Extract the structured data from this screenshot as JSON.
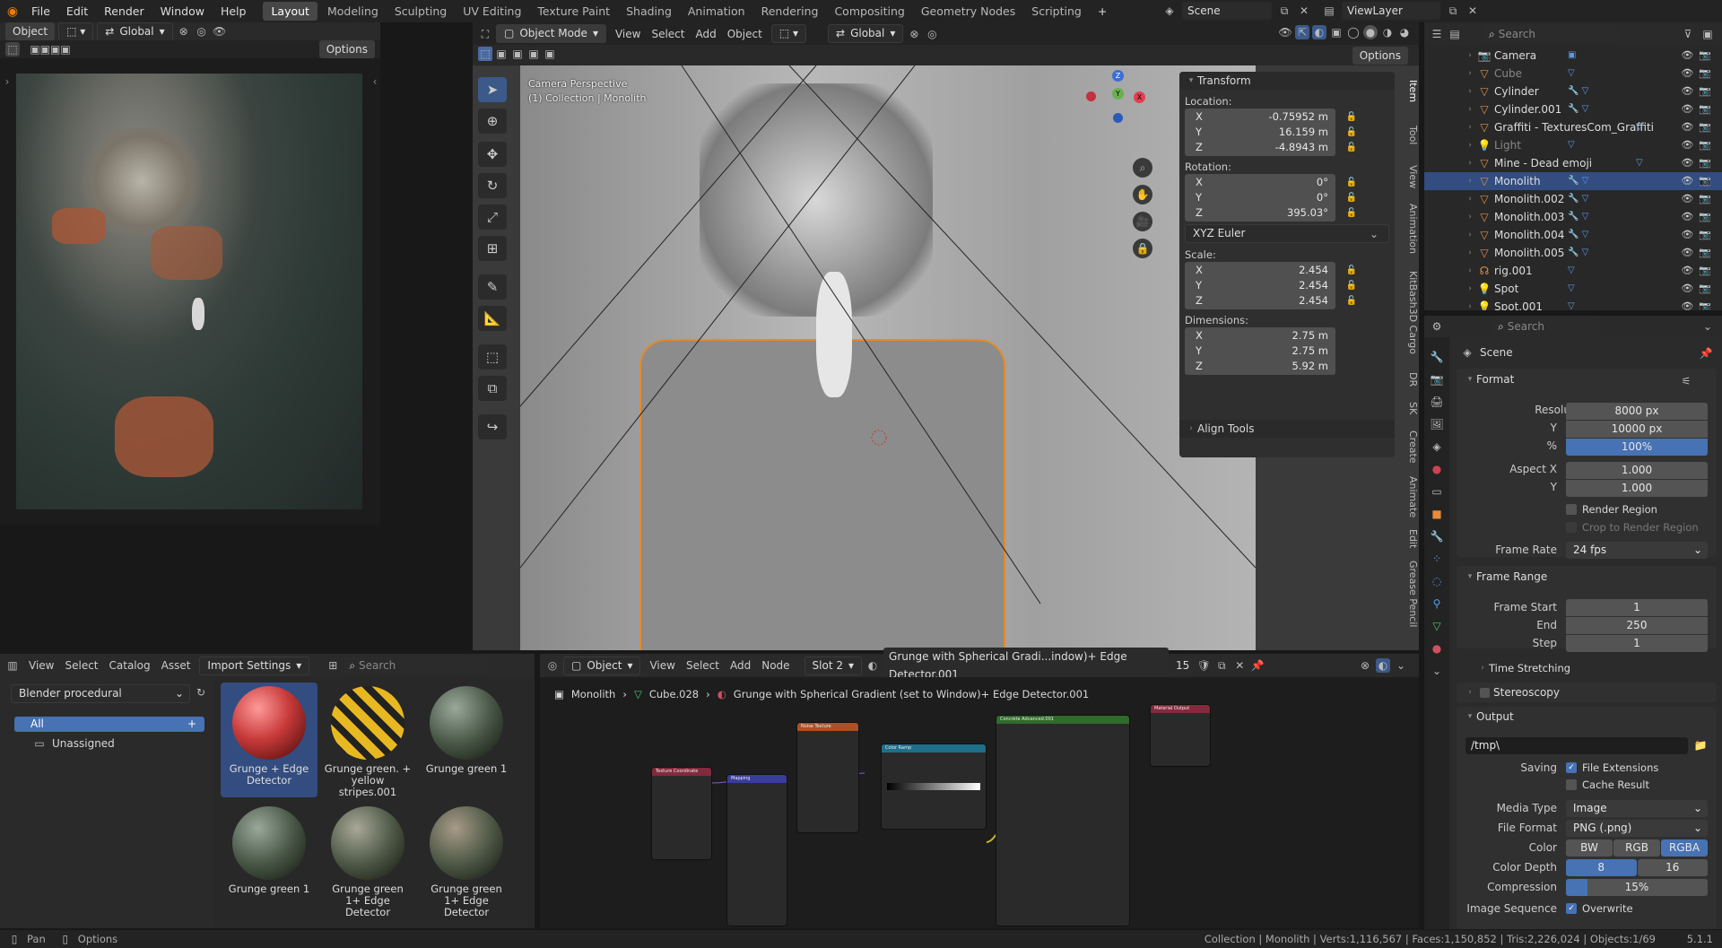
{
  "topbar": {
    "menus": [
      "File",
      "Edit",
      "Render",
      "Window",
      "Help"
    ],
    "workspaces": [
      "Layout",
      "Modeling",
      "Sculpting",
      "UV Editing",
      "Texture Paint",
      "Shading",
      "Animation",
      "Rendering",
      "Compositing",
      "Geometry Nodes",
      "Scripting"
    ],
    "active": "Layout",
    "scene": "Scene",
    "view_layer": "ViewLayer"
  },
  "image_editor": {
    "mode": "Object",
    "orientation": "Global",
    "options": "Options"
  },
  "viewport": {
    "mode": "Object Mode",
    "menus": [
      "View",
      "Select",
      "Add",
      "Object"
    ],
    "orientation": "Global",
    "options": "Options",
    "overlay_line1": "Camera Perspective",
    "overlay_line2": "(1) Collection | Monolith"
  },
  "transform": {
    "title": "Transform",
    "location_label": "Location:",
    "loc": [
      {
        "axis": "X",
        "value": "-0.75952 m"
      },
      {
        "axis": "Y",
        "value": "16.159 m"
      },
      {
        "axis": "Z",
        "value": "-4.8943 m"
      }
    ],
    "rotation_label": "Rotation:",
    "rot": [
      {
        "axis": "X",
        "value": "0°"
      },
      {
        "axis": "Y",
        "value": "0°"
      },
      {
        "axis": "Z",
        "value": "395.03°"
      }
    ],
    "euler": "XYZ Euler",
    "scale_label": "Scale:",
    "scale": [
      {
        "axis": "X",
        "value": "2.454"
      },
      {
        "axis": "Y",
        "value": "2.454"
      },
      {
        "axis": "Z",
        "value": "2.454"
      }
    ],
    "dims_label": "Dimensions:",
    "dims": [
      {
        "axis": "X",
        "value": "2.75 m"
      },
      {
        "axis": "Y",
        "value": "2.75 m"
      },
      {
        "axis": "Z",
        "value": "5.92 m"
      }
    ],
    "align_tools": "Align Tools"
  },
  "vtabs": [
    "Item",
    "Tool",
    "View",
    "Animation",
    "KitBash3D Cargo",
    "DR",
    "SK",
    "Create",
    "Animate",
    "Edit",
    "Grease Pencil"
  ],
  "outliner": {
    "search_placeholder": "Search",
    "items": [
      {
        "name": "Camera",
        "dim": false
      },
      {
        "name": "Cube",
        "dim": true
      },
      {
        "name": "Cylinder",
        "dim": false
      },
      {
        "name": "Cylinder.001",
        "dim": false
      },
      {
        "name": "Graffiti - TexturesCom_GraffitiTa",
        "dim": false
      },
      {
        "name": "Light",
        "dim": true
      },
      {
        "name": "Mine - Dead emoji",
        "dim": false
      },
      {
        "name": "Monolith",
        "dim": false
      },
      {
        "name": "Monolith.002",
        "dim": false
      },
      {
        "name": "Monolith.003",
        "dim": false
      },
      {
        "name": "Monolith.004",
        "dim": false
      },
      {
        "name": "Monolith.005",
        "dim": false
      },
      {
        "name": "rig.001",
        "dim": false
      },
      {
        "name": "Spot",
        "dim": false
      },
      {
        "name": "Spot.001",
        "dim": false
      }
    ],
    "selected": "Monolith"
  },
  "props": {
    "search_placeholder": "Search",
    "scene": "Scene",
    "format_title": "Format",
    "res_x_label": "Resolution X",
    "res_x": "8000 px",
    "res_y_label": "Y",
    "res_y": "10000 px",
    "pct_label": "%",
    "pct": "100%",
    "aspect_x_label": "Aspect X",
    "aspect_x": "1.000",
    "aspect_y_label": "Y",
    "aspect_y": "1.000",
    "render_region": "Render Region",
    "crop": "Crop to Render Region",
    "frame_rate_label": "Frame Rate",
    "frame_rate": "24 fps",
    "frame_range_title": "Frame Range",
    "start_label": "Frame Start",
    "start": "1",
    "end_label": "End",
    "end": "250",
    "step_label": "Step",
    "step": "1",
    "time_stretching": "Time Stretching",
    "stereoscopy": "Stereoscopy",
    "output_title": "Output",
    "path": "/tmp\\",
    "saving_label": "Saving",
    "file_ext": "File Extensions",
    "cache_result": "Cache Result",
    "media_label": "Media Type",
    "media": "Image",
    "format_label": "File Format",
    "file_format": "PNG (.png)",
    "color_label": "Color",
    "color_opts": [
      "BW",
      "RGB",
      "RGBA"
    ],
    "depth_label": "Color Depth",
    "depth_opts": [
      "8",
      "16"
    ],
    "compression_label": "Compression",
    "compression": "15%",
    "seq_label": "Image Sequence",
    "overwrite": "Overwrite"
  },
  "asset_browser": {
    "menus": [
      "View",
      "Select",
      "Catalog",
      "Asset"
    ],
    "import_settings": "Import Settings",
    "search_placeholder": "Search",
    "library": "Blender procedural",
    "catalog_all": "All",
    "catalog_unassigned": "Unassigned",
    "assets": [
      "Grunge + Edge Detector",
      "Grunge green. + yellow stripes.001",
      "Grunge green 1",
      "Grunge green 1",
      "Grunge green 1+ Edge Detector",
      "Grunge green 1+ Edge Detector"
    ]
  },
  "node_editor": {
    "type": "Object",
    "menus": [
      "View",
      "Select",
      "Add",
      "Node"
    ],
    "slot": "Slot 2",
    "material": "Grunge with Spherical Gradi...indow)+ Edge Detector.001",
    "users": "15",
    "bc_object": "Monolith",
    "bc_mesh": "Cube.028",
    "bc_material": "Grunge with Spherical Gradient (set to Window)+ Edge Detector.001",
    "nodes": {
      "texcoord": "Texture Coordinate",
      "mapping": "Mapping",
      "noise": "Noise Texture",
      "ramp": "Color Ramp",
      "concrete": "Concrete Advanced.001",
      "output": "Material Output"
    }
  },
  "status": {
    "pan": "Pan",
    "options": "Options",
    "stats": "Collection | Monolith | Verts:1,116,567 | Faces:1,150,852 | Tris:2,226,024 | Objects:1/69",
    "version": "5.1.1"
  }
}
